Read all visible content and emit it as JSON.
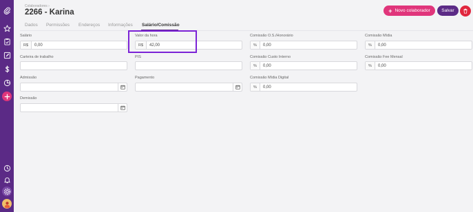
{
  "header": {
    "breadcrumb": "Colaboradores  ›",
    "title": "2266 - Karina",
    "new_button": "Novo colaborador",
    "save_button": "Salvar"
  },
  "tabs": [
    {
      "label": "Dados"
    },
    {
      "label": "Permissões"
    },
    {
      "label": "Endereços"
    },
    {
      "label": "Informações"
    },
    {
      "label": "Salário/Comissão"
    }
  ],
  "form": {
    "salario": {
      "label": "Salário",
      "prefix": "R$",
      "value": "0,00"
    },
    "valor_hora": {
      "label": "Valor da hora",
      "prefix": "R$",
      "value": "42,00"
    },
    "comissao_os": {
      "label": "Comissão O.S./Honorário",
      "prefix": "%",
      "value": "0,00"
    },
    "comissao_midia": {
      "label": "Comissão Mídia",
      "prefix": "%",
      "value": "0,00"
    },
    "carteira": {
      "label": "Carteira de trabalho",
      "value": ""
    },
    "pis": {
      "label": "PIS",
      "value": ""
    },
    "comissao_custo": {
      "label": "Comissão Custo Interno",
      "prefix": "%",
      "value": "0,00"
    },
    "comissao_fee": {
      "label": "Comissão Fee Mensal",
      "prefix": "%",
      "value": "0,00"
    },
    "admissao": {
      "label": "Admissão",
      "value": ""
    },
    "pagamento": {
      "label": "Pagamento",
      "value": ""
    },
    "comissao_digital": {
      "label": "Comissão Mídia Digital",
      "prefix": "%",
      "value": "0,00"
    },
    "demissao": {
      "label": "Demissão",
      "value": ""
    }
  },
  "sidebar_icons": [
    "paperclip-icon",
    "star-icon",
    "clipboard-icon",
    "edit-icon",
    "dollar-icon",
    "chart-icon",
    "plus-icon",
    "clock-icon",
    "bell-icon",
    "settings-icon",
    "avatar"
  ],
  "colors": {
    "primary": "#5b2a86",
    "accent": "#e0357b",
    "danger": "#e0263e",
    "highlight": "#7b22d6"
  }
}
